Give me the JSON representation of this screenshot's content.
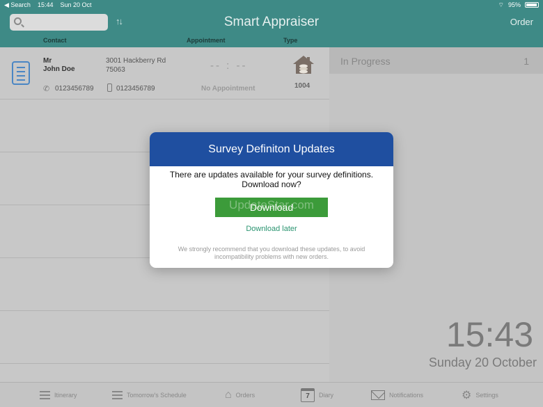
{
  "status_bar": {
    "back_label": "◀ Search",
    "time": "15:44",
    "date": "Sun 20 Oct",
    "battery": "95%"
  },
  "nav": {
    "title": "Smart Appraiser",
    "order_button": "Order",
    "search_placeholder": ""
  },
  "columns": {
    "contact": "Contact",
    "appointment": "Appointment",
    "type": "Type"
  },
  "order": {
    "title": "Mr",
    "name": "John Doe",
    "address_line1": "3001 Hackberry Rd",
    "address_line2": "75063",
    "phone": "0123456789",
    "mobile": "0123456789",
    "appointment_time": "-- : --",
    "appointment_status": "No Appointment",
    "order_number": "1004"
  },
  "right_panel": {
    "in_progress_label": "In Progress",
    "in_progress_count": "1",
    "clock_time": "15:43",
    "clock_date": "Sunday 20 October"
  },
  "tabs": [
    {
      "label": "Itinerary"
    },
    {
      "label": "Tomorrow's Schedule"
    },
    {
      "label": "Orders"
    },
    {
      "label": "Diary",
      "day": "7"
    },
    {
      "label": "Notifications"
    },
    {
      "label": "Settings"
    }
  ],
  "dialog": {
    "title": "Survey Definiton Updates",
    "message_line1": "There are updates available for your survey definitions.",
    "message_line2": "Download now?",
    "download_button": "Download",
    "later_link": "Download later",
    "note_line1": "We strongly recommend that you download these updates, to avoid",
    "note_line2": "incompatibility problems with new orders.",
    "watermark": "UpdateStar.com"
  },
  "colors": {
    "nav_teal": "#3e8a86",
    "dialog_blue": "#1f4fa0",
    "download_green": "#3c9b3a",
    "link_green": "#2a9470"
  }
}
